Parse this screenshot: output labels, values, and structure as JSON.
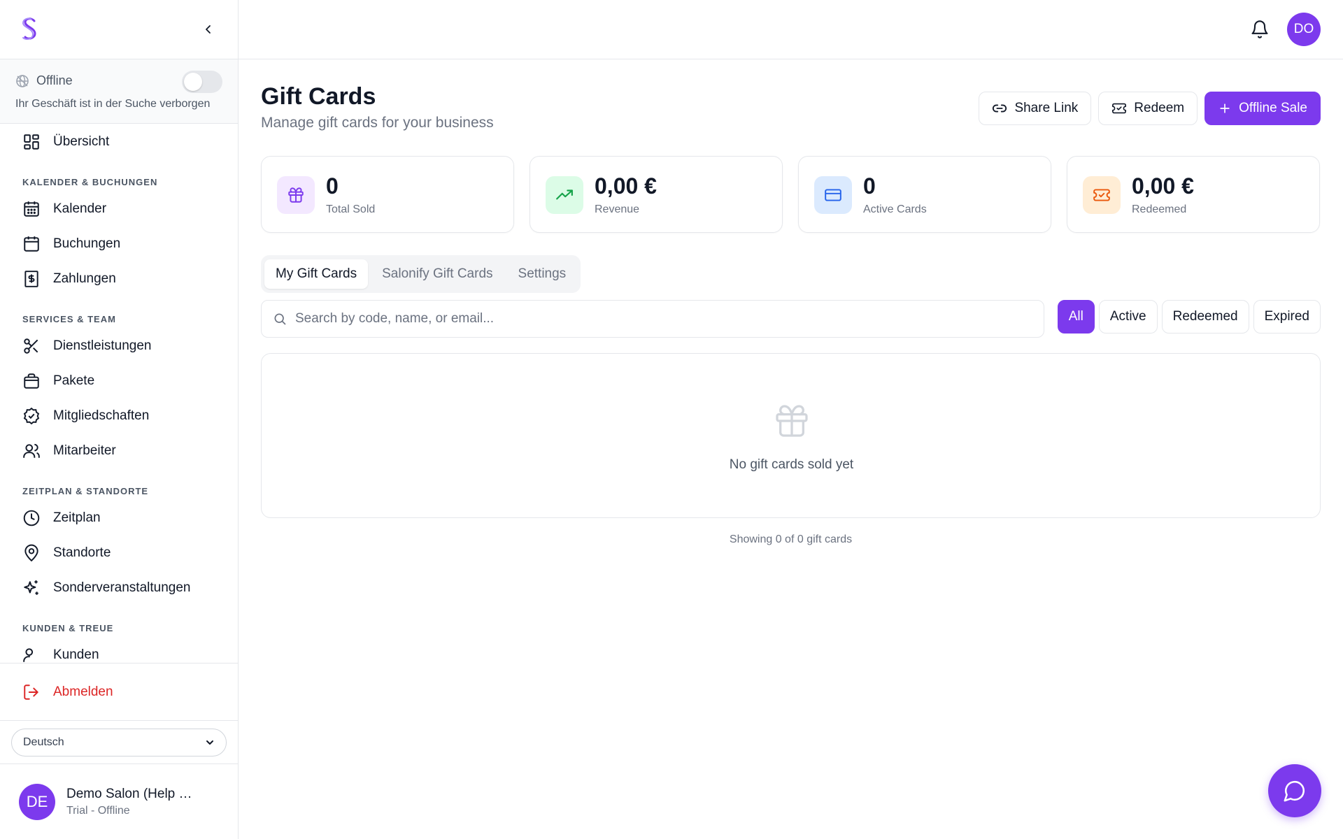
{
  "sidebar": {
    "status": {
      "label": "Offline",
      "description": "Ihr Geschäft ist in der Suche verborgen",
      "online": false
    },
    "overview": "Übersicht",
    "sections": [
      {
        "title": "KALENDER & BUCHUNGEN",
        "items": [
          "Kalender",
          "Buchungen",
          "Zahlungen"
        ]
      },
      {
        "title": "SERVICES & TEAM",
        "items": [
          "Dienstleistungen",
          "Pakete",
          "Mitgliedschaften",
          "Mitarbeiter"
        ]
      },
      {
        "title": "ZEITPLAN & STANDORTE",
        "items": [
          "Zeitplan",
          "Standorte",
          "Sonderveranstaltungen"
        ]
      },
      {
        "title": "KUNDEN & TREUE",
        "items": [
          "Kunden"
        ]
      }
    ],
    "logout": "Abmelden",
    "language": "Deutsch",
    "account": {
      "initials": "DE",
      "name": "Demo Salon (Help …",
      "plan": "Trial - Offline"
    }
  },
  "topbar": {
    "user_initials": "DO"
  },
  "page": {
    "title": "Gift Cards",
    "subtitle": "Manage gift cards for your business",
    "actions": {
      "share": "Share Link",
      "redeem": "Redeem",
      "offline_sale": "Offline Sale"
    }
  },
  "stats": [
    {
      "value": "0",
      "label": "Total Sold",
      "icon": "gift-icon",
      "color": "#7c3aed",
      "bg": "#f3e8ff"
    },
    {
      "value": "0,00 €",
      "label": "Revenue",
      "icon": "trending-up-icon",
      "color": "#16a34a",
      "bg": "#dcfce7"
    },
    {
      "value": "0",
      "label": "Active Cards",
      "icon": "credit-card-icon",
      "color": "#2563eb",
      "bg": "#dbeafe"
    },
    {
      "value": "0,00 €",
      "label": "Redeemed",
      "icon": "ticket-icon",
      "color": "#ea580c",
      "bg": "#ffedd5"
    }
  ],
  "tabs": [
    "My Gift Cards",
    "Salonify Gift Cards",
    "Settings"
  ],
  "search": {
    "placeholder": "Search by code, name, or email..."
  },
  "filters": [
    "All",
    "Active",
    "Redeemed",
    "Expired"
  ],
  "empty": {
    "message": "No gift cards sold yet"
  },
  "pagination": {
    "summary": "Showing 0 of 0 gift cards"
  },
  "colors": {
    "accent": "#7c3aed",
    "danger": "#dc2626"
  }
}
